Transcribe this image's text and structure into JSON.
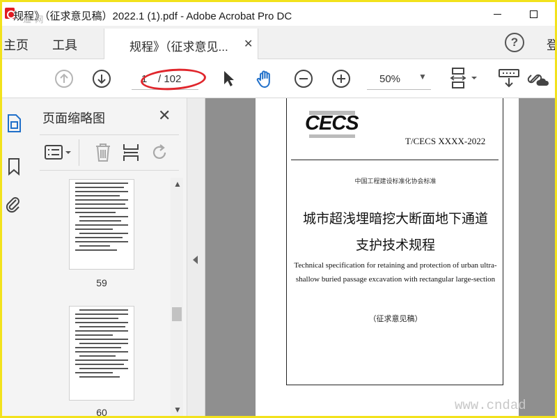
{
  "window": {
    "title": "规程》（征求意见稿）2022.1 (1).pdf - Adobe Acrobat Pro DC",
    "watermark": "遥 网"
  },
  "menu": {
    "home": "主页",
    "tools": "工具",
    "doc_tab": "规程》（征求意见...",
    "signin": "登"
  },
  "toolbar": {
    "current_page": "1",
    "total_pages": "/ 102",
    "zoom": "50%"
  },
  "thumbnails": {
    "title": "页面缩略图",
    "pages": [
      {
        "label": "59"
      },
      {
        "label": "60"
      }
    ]
  },
  "document": {
    "logo": "CECS",
    "standard_no": "T/CECS XXXX-2022",
    "association": "中国工程建设标准化协会标准",
    "title_cn_line1": "城市超浅埋暗挖大断面地下通道",
    "title_cn_line2": "支护技术规程",
    "title_en": "Technical specification for retaining and protection of urban ultra-shallow buried passage excavation with rectangular large-section",
    "draft": "（征求意见稿）"
  },
  "site_watermark": "www.cndad",
  "colors": {
    "frame": "#f2e21c",
    "annotation": "#e0262c",
    "hand_tool": "#1f6fc9"
  }
}
